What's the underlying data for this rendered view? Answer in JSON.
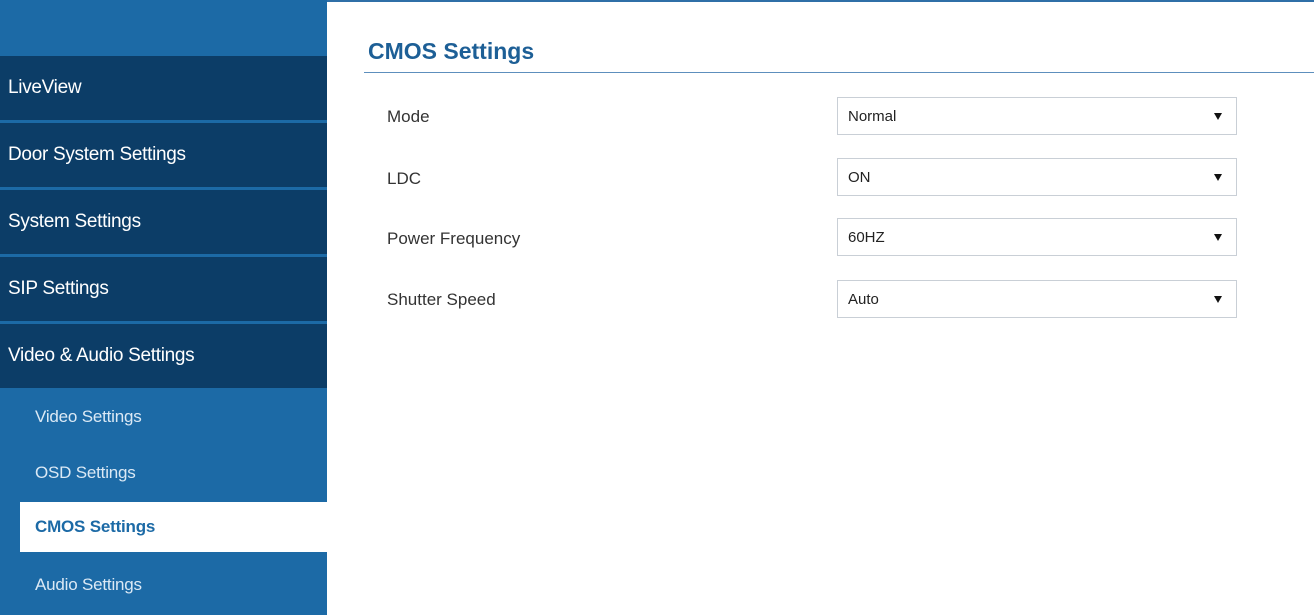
{
  "sidebar": {
    "main_items": [
      {
        "label": "LiveView"
      },
      {
        "label": "Door System Settings"
      },
      {
        "label": "System Settings"
      },
      {
        "label": "SIP Settings"
      },
      {
        "label": "Video & Audio Settings"
      }
    ],
    "sub_items": [
      {
        "label": "Video Settings",
        "active": false
      },
      {
        "label": "OSD Settings",
        "active": false
      },
      {
        "label": "CMOS Settings",
        "active": true
      },
      {
        "label": "Audio Settings",
        "active": false
      }
    ]
  },
  "main": {
    "title": "CMOS Settings",
    "settings": [
      {
        "label": "Mode",
        "value": "Normal"
      },
      {
        "label": "LDC",
        "value": "ON"
      },
      {
        "label": "Power Frequency",
        "value": "60HZ"
      },
      {
        "label": "Shutter Speed",
        "value": "Auto"
      }
    ]
  },
  "colors": {
    "sidebar_dark": "#0c3d67",
    "sidebar_light": "#1c6aa6",
    "title": "#1d5f96"
  }
}
